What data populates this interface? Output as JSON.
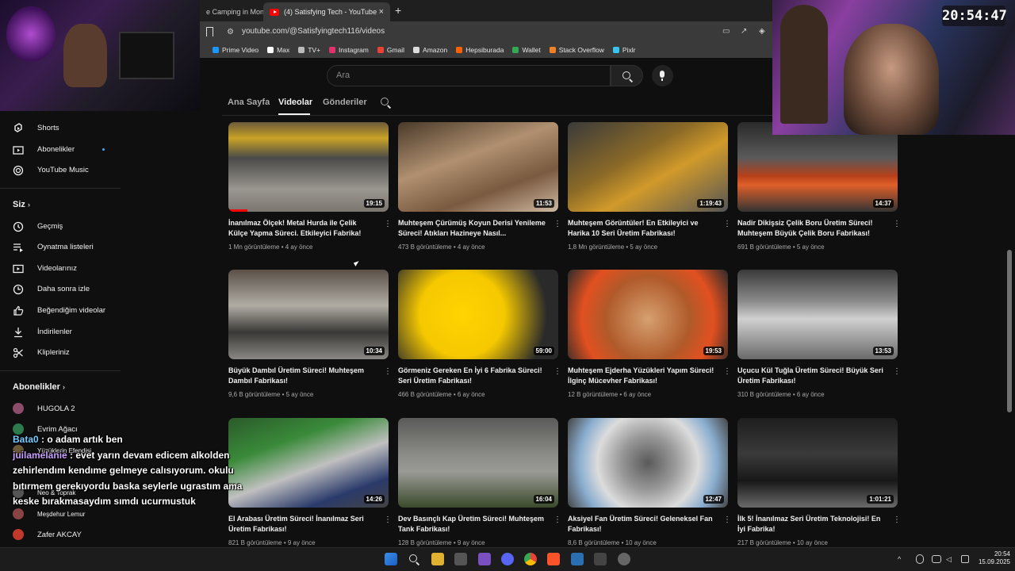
{
  "browser": {
    "tabs": [
      {
        "title": "e Camping in Mon"
      },
      {
        "title": "(4) Satisfying Tech - YouTube",
        "close": "×"
      }
    ],
    "new_tab": "+",
    "url": "youtube.com/@Satisfyingtech116/videos",
    "bookmarks": [
      {
        "label": "Prime Video",
        "color": "#1a98ff"
      },
      {
        "label": "Max",
        "color": "#ffffff"
      },
      {
        "label": "TV+",
        "color": "#bbbbbb"
      },
      {
        "label": "Instagram",
        "color": "#e1306c"
      },
      {
        "label": "Gmail",
        "color": "#ea4335"
      },
      {
        "label": "Amazon",
        "color": "#dddddd"
      },
      {
        "label": "Hepsiburada",
        "color": "#ff6000"
      },
      {
        "label": "Wallet",
        "color": "#34a853"
      },
      {
        "label": "Stack Overflow",
        "color": "#f48024"
      },
      {
        "label": "Pixlr",
        "color": "#36c5f0"
      }
    ]
  },
  "header": {
    "search_placeholder": "Ara"
  },
  "channel_tabs": [
    {
      "label": "Ana Sayfa"
    },
    {
      "label": "Videolar"
    },
    {
      "label": "Gönderiler"
    }
  ],
  "sidebar": {
    "top_items": [
      {
        "label": "Shorts"
      },
      {
        "label": "Abonelikler"
      },
      {
        "label": "YouTube Music"
      }
    ],
    "you_header": "Siz",
    "you_items": [
      {
        "label": "Geçmiş"
      },
      {
        "label": "Oynatma listeleri"
      },
      {
        "label": "Videolarınız"
      },
      {
        "label": "Daha sonra izle"
      },
      {
        "label": "Beğendiğim videolar"
      },
      {
        "label": "İndirilenler"
      },
      {
        "label": "Klipleriniz"
      }
    ],
    "subs_header": "Abonelikler",
    "subscriptions": [
      {
        "label": "HUGOLA 2"
      },
      {
        "label": "Evrim Ağacı"
      },
      {
        "label": "Yüzüklerin Efendisi"
      },
      {
        "label": "Neo & Toprak"
      },
      {
        "label": "Meşdehur Lemur"
      },
      {
        "label": "Zafer AKCAY"
      }
    ]
  },
  "videos": [
    {
      "title": "İnanılmaz Ölçek! Metal Hurda ile Çelik Külçe Yapma Süreci. Etkileyici Fabrika!",
      "views": "1 Mn görüntüleme",
      "age": "4 ay önce",
      "duration": "19:15"
    },
    {
      "title": "Muhteşem Çürümüş Koyun Derisi Yenileme Süreci! Atıkları Hazineye Nasıl...",
      "views": "473 B görüntüleme",
      "age": "4 ay önce",
      "duration": "11:53"
    },
    {
      "title": "Muhteşem Görüntüler! En Etkileyici ve Harika 10 Seri Üretim Fabrikası!",
      "views": "1,8 Mn görüntüleme",
      "age": "5 ay önce",
      "duration": "1:19:43"
    },
    {
      "title": "Nadir Dikişsiz Çelik Boru Üretim Süreci! Muhteşem Büyük Çelik Boru Fabrikası!",
      "views": "691 B görüntüleme",
      "age": "5 ay önce",
      "duration": "14:37"
    },
    {
      "title": "Büyük Dambıl Üretim Süreci! Muhteşem Dambıl Fabrikası!",
      "views": "9,6 B görüntüleme",
      "age": "5 ay önce",
      "duration": "10:34"
    },
    {
      "title": "Görmeniz Gereken En İyi 6 Fabrika Süreci! Seri Üretim Fabrikası!",
      "views": "466 B görüntüleme",
      "age": "6 ay önce",
      "duration": "59:00"
    },
    {
      "title": "Muhteşem Ejderha Yüzükleri Yapım Süreci! İlginç Mücevher Fabrikası!",
      "views": "12 B görüntüleme",
      "age": "6 ay önce",
      "duration": "19:53"
    },
    {
      "title": "Uçucu Kül Tuğla Üretim Süreci! Büyük Seri Üretim Fabrikası!",
      "views": "310 B görüntüleme",
      "age": "6 ay önce",
      "duration": "13:53"
    },
    {
      "title": "El Arabası Üretim Süreci! İnanılmaz Seri Üretim Fabrikası!",
      "views": "821 B görüntüleme",
      "age": "9 ay önce",
      "duration": "14:26"
    },
    {
      "title": "Dev Basınçlı Kap Üretim Süreci! Muhteşem Tank Fabrikası!",
      "views": "128 B görüntüleme",
      "age": "9 ay önce",
      "duration": "16:04"
    },
    {
      "title": "Aksiyel Fan Üretim Süreci! Geleneksel Fan Fabrikası!",
      "views": "8,6 B görüntüleme",
      "age": "10 ay önce",
      "duration": "12:47"
    },
    {
      "title": "İlk 5! İnanılmaz Seri Üretim Teknolojisi! En İyi Fabrika!",
      "views": "217 B görüntüleme",
      "age": "10 ay önce",
      "duration": "1:01:21"
    }
  ],
  "overlay": {
    "clock": "20:54:47",
    "chat": [
      {
        "user": "Bata0",
        "text": " : o adam artık ben"
      },
      {
        "user": "juilamelanie",
        "text": " : evet yarın devam edicem alkolden zehirlendım kendıme gelmeye calısıyorum. okulu bıtırmem gerekıyordu baska seylerle ugrastım ama keske bırakmasaydım sımdı ucurmustuk"
      }
    ]
  },
  "taskbar": {
    "time": "20:54",
    "date": "15.09.2025"
  },
  "colors": {
    "yt_red": "#ff0000",
    "accent_blue": "#3ea6ff",
    "bg": "#0f0f0f"
  }
}
